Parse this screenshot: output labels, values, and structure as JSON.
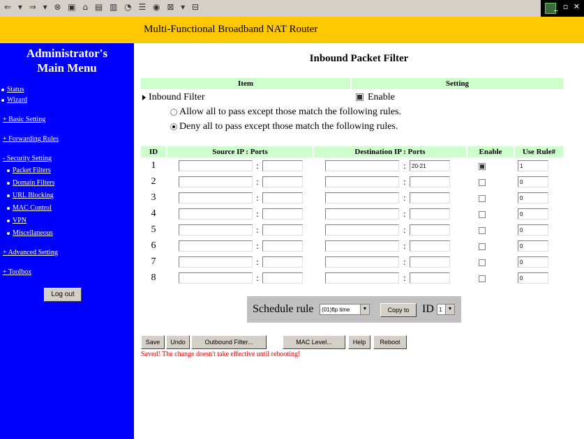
{
  "header": {
    "title": "Multi-Functional Broadband NAT Router"
  },
  "sidebar": {
    "title_line1": "Administrator's",
    "title_line2": "Main Menu",
    "items": {
      "status": "Status",
      "wizard": "Wizard",
      "basic": "+ Basic Setting",
      "forwarding": "+ Forwarding Rules",
      "security": "- Security Setting",
      "packet": "Packet Filters",
      "domain": "Domain Filters",
      "url": "URL Blocking",
      "mac": "MAC Control",
      "vpn": "VPN",
      "misc": "Miscellaneous",
      "advanced": "+ Advanced Setting",
      "toolbox": "+ Toolbox"
    },
    "logout": "Log out"
  },
  "main": {
    "page_title": "Inbound Packet Filter",
    "item_header": "Item",
    "setting_header": "Setting",
    "filter_label": "Inbound Filter",
    "enable_label": "Enable",
    "enable_checked": true,
    "allow_label": "Allow all to pass except those match the following rules.",
    "deny_label": "Deny all to pass except those match the following rules.",
    "selected_mode": "deny",
    "columns": {
      "id": "ID",
      "source": "Source IP : Ports",
      "dest": "Destination IP : Ports",
      "enable": "Enable",
      "rule": "Use Rule#"
    },
    "rows": [
      {
        "id": "1",
        "src_ip": "",
        "src_port": "",
        "dst_ip": "",
        "dst_port": "20-21",
        "enabled": true,
        "rule": "1"
      },
      {
        "id": "2",
        "src_ip": "",
        "src_port": "",
        "dst_ip": "",
        "dst_port": "",
        "enabled": false,
        "rule": "0"
      },
      {
        "id": "3",
        "src_ip": "",
        "src_port": "",
        "dst_ip": "",
        "dst_port": "",
        "enabled": false,
        "rule": "0"
      },
      {
        "id": "4",
        "src_ip": "",
        "src_port": "",
        "dst_ip": "",
        "dst_port": "",
        "enabled": false,
        "rule": "0"
      },
      {
        "id": "5",
        "src_ip": "",
        "src_port": "",
        "dst_ip": "",
        "dst_port": "",
        "enabled": false,
        "rule": "0"
      },
      {
        "id": "6",
        "src_ip": "",
        "src_port": "",
        "dst_ip": "",
        "dst_port": "",
        "enabled": false,
        "rule": "0"
      },
      {
        "id": "7",
        "src_ip": "",
        "src_port": "",
        "dst_ip": "",
        "dst_port": "",
        "enabled": false,
        "rule": "0"
      },
      {
        "id": "8",
        "src_ip": "",
        "src_port": "",
        "dst_ip": "",
        "dst_port": "",
        "enabled": false,
        "rule": "0"
      }
    ],
    "schedule": {
      "label": "Schedule rule",
      "selected": "(01)ftp time",
      "copy_to": "Copy to",
      "id_label": "ID",
      "id_value": "1"
    },
    "buttons": {
      "save": "Save",
      "undo": "Undo",
      "outbound": "Outbound Filter...",
      "mac_level": "MAC Level...",
      "help": "Help",
      "reboot": "Reboot"
    },
    "status_message": "Saved! The change doesn't take effective until rebooting!"
  },
  "colors": {
    "header": "#ffc800",
    "sidebar": "#0000ff",
    "table_header": "#ccffcc",
    "status": "#d00000"
  }
}
